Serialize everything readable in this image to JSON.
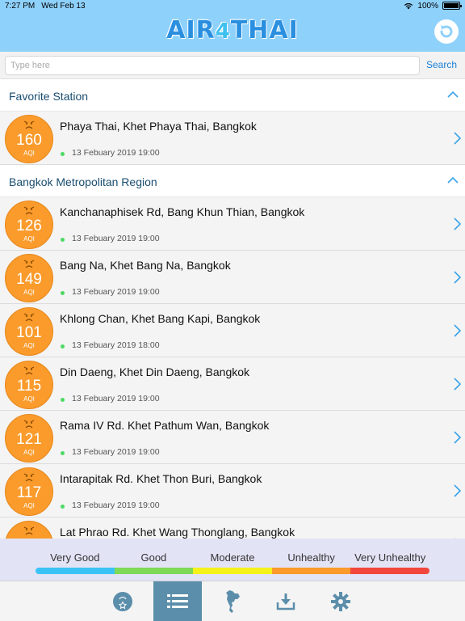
{
  "status_bar": {
    "time": "7:27 PM",
    "date": "Wed Feb 13",
    "battery": "100%"
  },
  "header": {
    "logo_part1": "AIR",
    "logo_part2": "4",
    "logo_part3": "THAI"
  },
  "search": {
    "placeholder": "Type here",
    "button_label": "Search"
  },
  "sections": [
    {
      "title": "Favorite Station",
      "stations": [
        {
          "aqi": "160",
          "unit": "AQI",
          "name": "Phaya Thai, Khet Phaya Thai, Bangkok",
          "time": "13 Febuary 2019 19:00"
        }
      ]
    },
    {
      "title": "Bangkok Metropolitan Region",
      "stations": [
        {
          "aqi": "126",
          "unit": "AQI",
          "name": "Kanchanaphisek Rd, Bang Khun Thian, Bangkok",
          "time": "13 Febuary 2019 19:00"
        },
        {
          "aqi": "149",
          "unit": "AQI",
          "name": "Bang Na, Khet Bang Na, Bangkok",
          "time": "13 Febuary 2019 19:00"
        },
        {
          "aqi": "101",
          "unit": "AQI",
          "name": "Khlong Chan, Khet Bang Kapi, Bangkok",
          "time": "13 Febuary 2019 18:00"
        },
        {
          "aqi": "115",
          "unit": "AQI",
          "name": "Din Daeng, Khet Din Daeng, Bangkok",
          "time": "13 Febuary 2019 19:00"
        },
        {
          "aqi": "121",
          "unit": "AQI",
          "name": "Rama IV Rd. Khet Pathum Wan, Bangkok",
          "time": "13 Febuary 2019 19:00"
        },
        {
          "aqi": "117",
          "unit": "AQI",
          "name": "Intarapitak Rd. Khet Thon Buri, Bangkok",
          "time": "13 Febuary 2019 19:00"
        },
        {
          "aqi": "",
          "unit": "",
          "name": "Lat Phrao Rd. Khet Wang Thonglang, Bangkok",
          "time": ""
        }
      ]
    }
  ],
  "legend": {
    "items": [
      {
        "label": "Very Good",
        "color": "#3cc3f5"
      },
      {
        "label": "Good",
        "color": "#7ed957"
      },
      {
        "label": "Moderate",
        "color": "#f5f21b"
      },
      {
        "label": "Unhealthy",
        "color": "#fa9b2c"
      },
      {
        "label": "Very Unhealthy",
        "color": "#f2473c"
      }
    ]
  },
  "tabs": [
    {
      "icon": "favorite-star-icon",
      "active": false
    },
    {
      "icon": "list-icon",
      "active": true
    },
    {
      "icon": "thailand-map-icon",
      "active": false
    },
    {
      "icon": "download-icon",
      "active": false
    },
    {
      "icon": "gear-icon",
      "active": false
    }
  ],
  "colors": {
    "accent": "#8ed1fb",
    "aqi_orange": "#fa9b2c",
    "link": "#1a7fd6",
    "active_tab": "#5b8eaa"
  }
}
